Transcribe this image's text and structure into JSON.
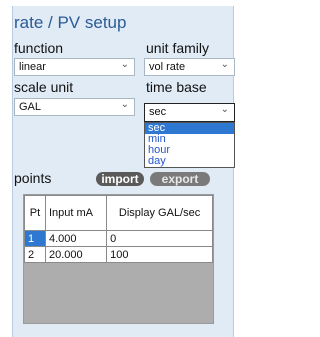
{
  "panel": {
    "title": "rate / PV setup"
  },
  "function": {
    "label": "function",
    "value": "linear"
  },
  "unit_family": {
    "label": "unit family",
    "value": "vol rate"
  },
  "scale_unit": {
    "label": "scale unit",
    "value": "GAL"
  },
  "time_base": {
    "label": "time base",
    "value": "sec",
    "options": [
      "sec",
      "min",
      "hour",
      "day"
    ],
    "selected_index": 0
  },
  "points": {
    "label": "points",
    "import_label": "import",
    "export_label": "export",
    "columns": [
      "Pt",
      "Input mA",
      "Display GAL/sec"
    ],
    "rows": [
      [
        "1",
        "4.000",
        "0"
      ],
      [
        "2",
        "20.000",
        "100"
      ]
    ]
  },
  "colors": {
    "title": "#2a5b94",
    "panel_bg": "#e1ebf6",
    "selection": "#2f78d2"
  },
  "icons": {
    "select_chevron": "chevron-down-icon"
  }
}
